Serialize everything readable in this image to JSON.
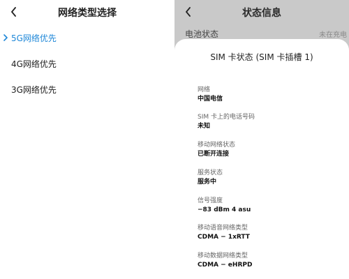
{
  "left_panel": {
    "title": "网络类型选择",
    "options": [
      {
        "label": "5G网络优先",
        "selected": true
      },
      {
        "label": "4G网络优先",
        "selected": false
      },
      {
        "label": "3G网络优先",
        "selected": false
      }
    ],
    "accent_color": "#1e87d8"
  },
  "right_panel": {
    "title": "状态信息",
    "background_row": {
      "label": "电池状态",
      "value": "未在充电"
    }
  },
  "sheet": {
    "title": "SIM 卡状态 (SIM 卡插槽 1)",
    "fields": [
      {
        "label": "网络",
        "value": "中国电信"
      },
      {
        "label": "SIM 卡上的电话号码",
        "value": "未知"
      },
      {
        "label": "移动网络状态",
        "value": "已断开连接"
      },
      {
        "label": "服务状态",
        "value": "服务中"
      },
      {
        "label": "信号强度",
        "value": "−83 dBm 4 asu"
      },
      {
        "label": "移动语音网络类型",
        "value": "CDMA − 1xRTT"
      },
      {
        "label": "移动数据网络类型",
        "value": "CDMA − eHRPD"
      }
    ]
  }
}
